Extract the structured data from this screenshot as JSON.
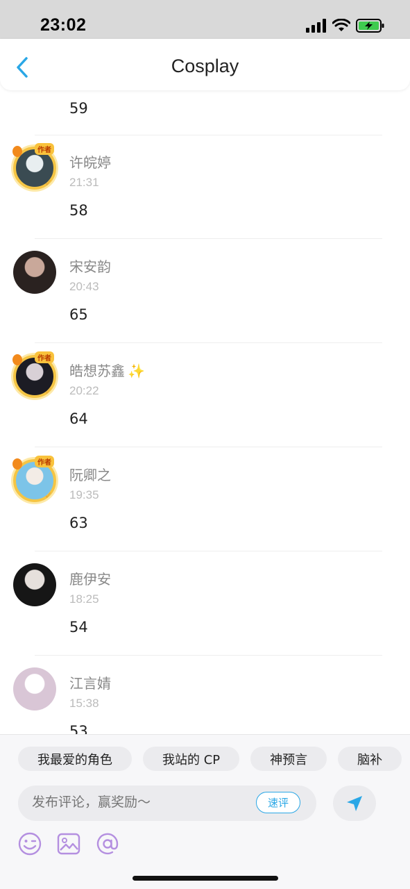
{
  "status": {
    "time": "23:02"
  },
  "nav": {
    "title": "Cosplay"
  },
  "first_item": {
    "value": "59"
  },
  "comments": [
    {
      "name": "许皖婷",
      "time": "21:31",
      "value": "58",
      "framed": true,
      "frame_badge": "作者",
      "avatar_colors": [
        "#3a4b52",
        "#e8eef0"
      ]
    },
    {
      "name": "宋安韵",
      "time": "20:43",
      "value": "65",
      "framed": false,
      "avatar_colors": [
        "#2a2220",
        "#c9a89a"
      ]
    },
    {
      "name": "皓想苏鑫",
      "name_suffix": "✨",
      "time": "20:22",
      "value": "64",
      "framed": true,
      "frame_badge": "作者",
      "avatar_colors": [
        "#1c1c24",
        "#d8d0d6"
      ]
    },
    {
      "name": "阮卿之",
      "time": "19:35",
      "value": "63",
      "framed": true,
      "frame_badge": "作者",
      "avatar_colors": [
        "#7cc4e8",
        "#f3ece6"
      ]
    },
    {
      "name": "鹿伊安",
      "time": "18:25",
      "value": "54",
      "framed": false,
      "avatar_colors": [
        "#161616",
        "#e6e0dc"
      ]
    },
    {
      "name": "江言婧",
      "time": "15:38",
      "value": "53",
      "framed": false,
      "avatar_colors": [
        "#d9c6d6",
        "#ffffff"
      ]
    }
  ],
  "chips": [
    "我最爱的角色",
    "我站的 CP",
    "神预言",
    "脑补"
  ],
  "input": {
    "placeholder": "发布评论，赢奖励～",
    "quick_label": "速评"
  },
  "tools": [
    "emoji-icon",
    "image-icon",
    "mention-icon"
  ],
  "colors": {
    "accent": "#2aa7e6",
    "tool_icon": "#b48fe0",
    "frame": "#f5c544"
  }
}
